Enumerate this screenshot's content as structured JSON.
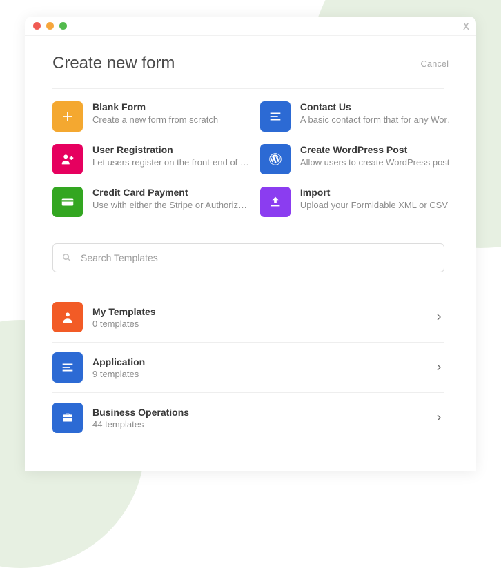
{
  "header": {
    "title": "Create new form",
    "cancel_label": "Cancel"
  },
  "starters": [
    {
      "title": "Blank Form",
      "desc": "Create a new form from scratch",
      "icon": "plus",
      "color": "orange"
    },
    {
      "title": "Contact Us",
      "desc": "A basic contact form that for any Wor…",
      "icon": "lines",
      "color": "blue"
    },
    {
      "title": "User Registration",
      "desc": "Let users register on the front-end of …",
      "icon": "user-plus",
      "color": "magenta"
    },
    {
      "title": "Create WordPress Post",
      "desc": "Allow users to create WordPress post…",
      "icon": "wordpress",
      "color": "dblue"
    },
    {
      "title": "Credit Card Payment",
      "desc": "Use with either the Stripe or Authoriz…",
      "icon": "card",
      "color": "green"
    },
    {
      "title": "Import",
      "desc": "Upload your Formidable XML or CSV …",
      "icon": "upload",
      "color": "purple"
    }
  ],
  "search": {
    "placeholder": "Search Templates"
  },
  "categories": [
    {
      "title": "My Templates",
      "sub": "0 templates",
      "icon": "user",
      "color": "dorange"
    },
    {
      "title": "Application",
      "sub": "9 templates",
      "icon": "lines",
      "color": "midblue"
    },
    {
      "title": "Business Operations",
      "sub": "44 templates",
      "icon": "briefcase",
      "color": "midblue"
    }
  ]
}
